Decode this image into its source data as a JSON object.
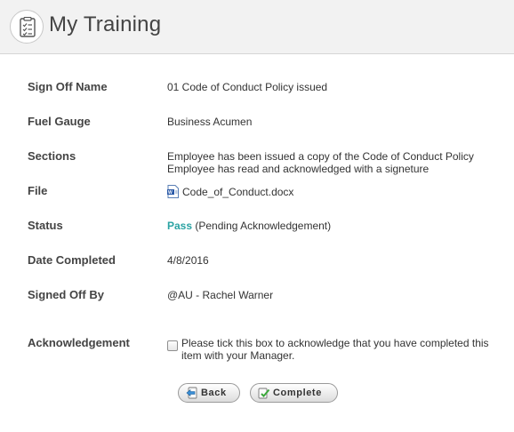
{
  "header": {
    "title": "My Training",
    "icon": "checklist-clipboard-icon"
  },
  "details": {
    "sign_off_name": {
      "label": "Sign Off Name",
      "value": "01 Code of Conduct Policy issued"
    },
    "fuel_gauge": {
      "label": "Fuel Gauge",
      "value": "Business Acumen"
    },
    "sections": {
      "label": "Sections",
      "lines": [
        "Employee has been issued a copy of the Code of Conduct Policy",
        "Employee has read and acknowledged with a signeture"
      ]
    },
    "file": {
      "label": "File",
      "value": "Code_of_Conduct.docx",
      "icon": "word-document-icon"
    },
    "status": {
      "label": "Status",
      "result": "Pass",
      "note": "(Pending Acknowledgement)",
      "result_color": "#2ba3a3"
    },
    "date_completed": {
      "label": "Date Completed",
      "value": "4/8/2016"
    },
    "signed_off_by": {
      "label": "Signed Off By",
      "value": "@AU - Rachel Warner"
    }
  },
  "acknowledgement": {
    "label": "Acknowledgement",
    "checked": false,
    "text": "Please tick this box to acknowledge that you have completed this item with your Manager."
  },
  "buttons": {
    "back_label": "Back",
    "complete_label": "Complete"
  }
}
